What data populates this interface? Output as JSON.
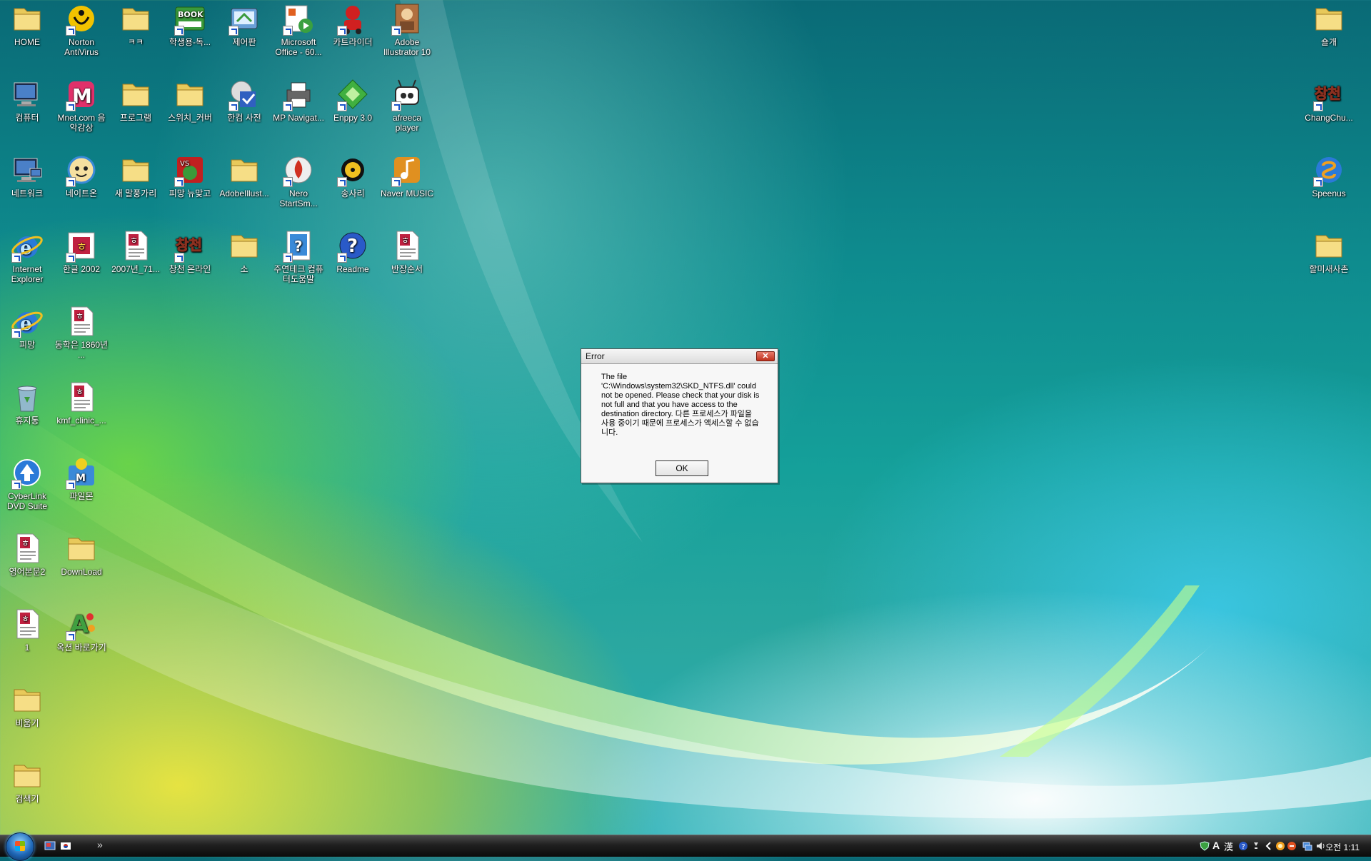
{
  "desktop": {
    "icons_left": [
      {
        "label": "HOME",
        "icon": "folder-icon",
        "color": "#e8c95a"
      },
      {
        "label": "Norton AntiVirus",
        "icon": "norton-icon",
        "color": "#f2c200"
      },
      {
        "label": "ㅋㅋ",
        "icon": "folder-icon",
        "color": "#e8c95a"
      },
      {
        "label": "학생용-독...",
        "icon": "book-icon",
        "color": "#3a9a3a"
      },
      {
        "label": "제어판",
        "icon": "control-panel-icon",
        "color": "#6aa0d8"
      },
      {
        "label": "Microsoft Office - 60...",
        "icon": "office-icon",
        "color": "#3aa040"
      },
      {
        "label": "카트라이더",
        "icon": "kartrider-icon",
        "color": "#d02020"
      },
      {
        "label": "Adobe Illustrator 10",
        "icon": "illustrator-icon",
        "color": "#b07040"
      },
      {
        "label": "컴퓨터",
        "icon": "computer-icon",
        "color": "#4a80c8"
      },
      {
        "label": "Mnet.com 음악감상",
        "icon": "mnet-icon",
        "color": "#e0306a"
      },
      {
        "label": "프로그램",
        "icon": "folder-icon",
        "color": "#e8c95a"
      },
      {
        "label": "스위치_커버",
        "icon": "folder-icon",
        "color": "#e8c95a"
      },
      {
        "label": "한컴 사전",
        "icon": "dictionary-icon",
        "color": "#3060c0"
      },
      {
        "label": "MP Navigat...",
        "icon": "printer-icon",
        "color": "#666666"
      },
      {
        "label": "Enppy 3.0",
        "icon": "enppy-icon",
        "color": "#40b040"
      },
      {
        "label": "afreeca player",
        "icon": "tv-icon",
        "color": "#2a2a2a"
      },
      {
        "label": "네트워크",
        "icon": "network-icon",
        "color": "#4a80c8"
      },
      {
        "label": "네이트온",
        "icon": "nateon-icon",
        "color": "#3a8ad8"
      },
      {
        "label": "새 말풍가리",
        "icon": "folder-icon",
        "color": "#e8c95a"
      },
      {
        "label": "피망 뉴맞고",
        "icon": "game-icon",
        "color": "#c02020"
      },
      {
        "label": "AdobeIllust...",
        "icon": "folder-icon",
        "color": "#e8c95a"
      },
      {
        "label": "Nero StartSm...",
        "icon": "nero-icon",
        "color": "#d03020"
      },
      {
        "label": "송사리",
        "icon": "songsari-icon",
        "color": "#f0c020"
      },
      {
        "label": "Naver MUSIC",
        "icon": "music-icon",
        "color": "#e09020"
      },
      {
        "label": "Internet Explorer",
        "icon": "ie-icon",
        "color": "#2a7ad8"
      },
      {
        "label": "한글 2002",
        "icon": "hwp-icon",
        "color": "#c02040"
      },
      {
        "label": "2007년_71...",
        "icon": "hwp-document-icon",
        "color": "#c02040"
      },
      {
        "label": "창천 온라인",
        "icon": "changchun-icon",
        "color": "#8a3020"
      },
      {
        "label": "소",
        "icon": "folder-icon",
        "color": "#e8c95a"
      },
      {
        "label": "주연테크 컴퓨터도움말",
        "icon": "help-file-icon",
        "color": "#3a8ad8"
      },
      {
        "label": "Readme",
        "icon": "help-icon",
        "color": "#2a5ac8"
      },
      {
        "label": "반장순서",
        "icon": "hwp-document-icon",
        "color": "#c02040"
      },
      {
        "label": "피망",
        "icon": "ie-icon",
        "color": "#2a7ad8"
      },
      {
        "label": "동학은 1860년 ...",
        "icon": "hwp-document-icon",
        "color": "#c02040"
      },
      {
        "label": "휴지통",
        "icon": "recycle-bin-icon",
        "color": "#9ab8d8"
      },
      {
        "label": "kmf_clinic_...",
        "icon": "hwp-document-icon",
        "color": "#c02040"
      },
      {
        "label": "CyberLink DVD Suite",
        "icon": "cyberlink-icon",
        "color": "#2a7ad8"
      },
      {
        "label": "파일몬",
        "icon": "filemon-icon",
        "color": "#3a8ad8"
      },
      {
        "label": "영어본문2",
        "icon": "hwp-document-icon",
        "color": "#c02040"
      },
      {
        "label": "DownLoad",
        "icon": "folder-icon",
        "color": "#e8c95a"
      },
      {
        "label": "1",
        "icon": "hwp-document-icon",
        "color": "#c02040"
      },
      {
        "label": "옥션 바로가기",
        "icon": "auction-icon",
        "color": "#40a040"
      },
      {
        "label": "비움기",
        "icon": "folder-icon",
        "color": "#e8c95a"
      },
      {
        "label": "검색기",
        "icon": "folder-icon",
        "color": "#e8c95a"
      }
    ],
    "icons_right": [
      {
        "label": "숄개",
        "icon": "folder-icon",
        "color": "#e8c95a"
      },
      {
        "label": "ChangChu...",
        "icon": "changchun-icon",
        "color": "#8a3020"
      },
      {
        "label": "Speenus",
        "icon": "speenus-icon",
        "color": "#2a7ad8"
      },
      {
        "label": "할미새사촌",
        "icon": "folder-icon",
        "color": "#e8c95a"
      }
    ]
  },
  "dialog": {
    "title": "Error",
    "close_label": "✕",
    "message": "The file 'C:\\Windows\\system32\\SKD_NTFS.dll' could not be opened. Please check that your disk is not full and that you have access to the destination directory. 다른 프로세스가 파일을 사용 중이기 때문에 프로세스가 액세스할 수 없습니다.",
    "ok_label": "OK"
  },
  "taskbar": {
    "overflow_label": "»",
    "clock": "오전 1:11",
    "tray_text_a": "A",
    "tray_text_han": "漢",
    "tray_help": "?"
  }
}
